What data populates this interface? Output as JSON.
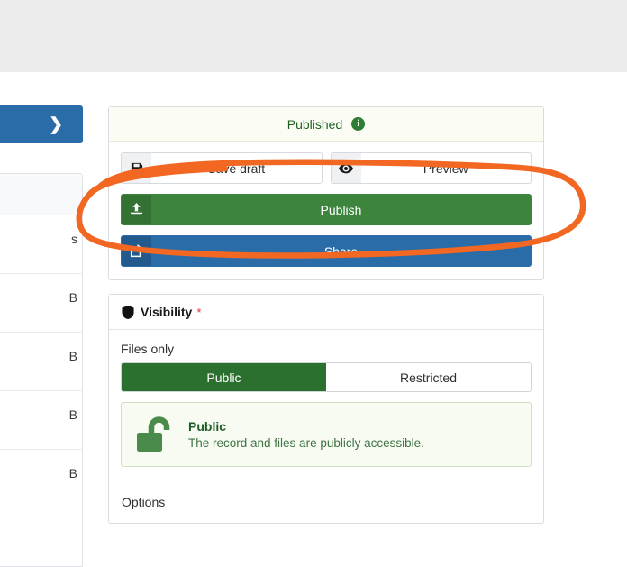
{
  "left_column": {
    "collapse_button": {
      "icon": "chevron-right-icon",
      "label": "❯"
    },
    "table": {
      "header_text": "",
      "rows": [
        {
          "trailing_text": "s"
        },
        {
          "trailing_text": "B"
        },
        {
          "trailing_text": "B"
        },
        {
          "trailing_text": "B"
        },
        {
          "trailing_text": "B"
        }
      ]
    }
  },
  "publish_panel": {
    "status_label": "Published",
    "info_icon": "info-circle-icon",
    "info_glyph": "i",
    "buttons": {
      "save_draft": {
        "label": "Save draft",
        "icon": "save-floppy-icon"
      },
      "preview": {
        "label": "Preview",
        "icon": "eye-icon"
      },
      "publish": {
        "label": "Publish",
        "icon": "upload-icon"
      },
      "share": {
        "label": "Share",
        "icon": "share-external-icon"
      }
    }
  },
  "visibility_panel": {
    "title": "Visibility",
    "required_marker": "*",
    "shield_icon": "shield-icon",
    "files_only_label": "Files only",
    "segmented": {
      "options": [
        {
          "label": "Public",
          "state": "active"
        },
        {
          "label": "Restricted",
          "state": "inactive"
        }
      ]
    },
    "info_box": {
      "icon": "unlock-icon",
      "heading": "Public",
      "description": "The record and files are publicly accessible."
    },
    "options_label": "Options"
  },
  "annotation": {
    "type": "hand-drawn-ellipse",
    "color": "#f26722",
    "targets": "publish-button"
  },
  "colors": {
    "publish_green": "#3d853d",
    "share_blue": "#2a6ca8",
    "segment_active_green": "#2c7030",
    "published_text_green": "#1e6022",
    "annotation_orange": "#f26722",
    "top_band_gray": "#ececec"
  }
}
